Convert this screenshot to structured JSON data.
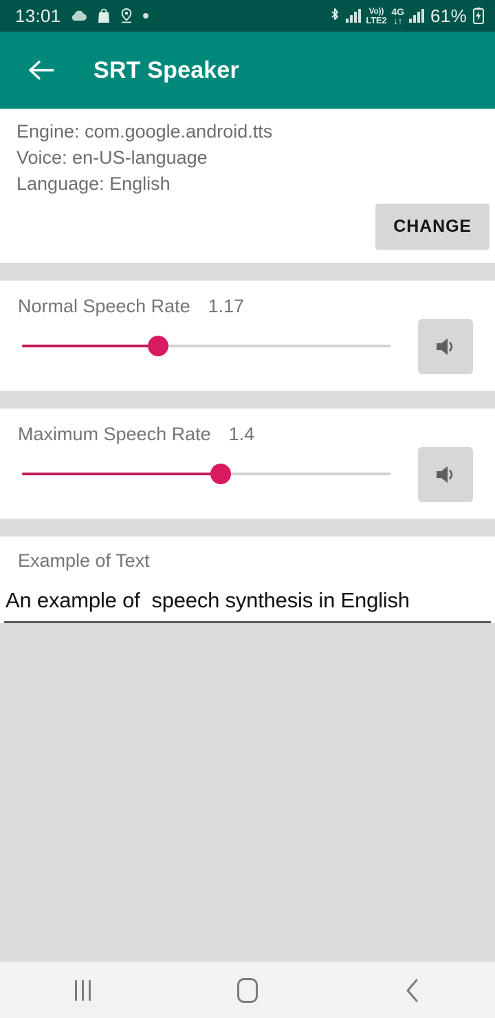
{
  "status_bar": {
    "clock": "13:01",
    "left_icons": [
      "cloud-icon",
      "shopping-bag-icon",
      "location-pin-icon",
      "dot-icon"
    ],
    "bluetooth_icon": "bluetooth-icon",
    "signal_icon_1": "signal-bars-icon",
    "volte_line1": "Vo))",
    "volte_line2": "LTE2",
    "network_type": "4G",
    "data_arrows": "↓↑",
    "signal_icon_2": "signal-bars-icon",
    "battery_percent": "61%",
    "battery_icon": "battery-charging-icon",
    "bg_color": "#005449"
  },
  "app_bar": {
    "back_icon": "arrow-left-icon",
    "title": "SRT Speaker",
    "bg_color": "#00897b"
  },
  "engine_info": {
    "engine": "Engine: com.google.android.tts",
    "voice": "Voice: en-US-language",
    "language": "Language: English"
  },
  "change_button": {
    "label": "CHANGE"
  },
  "normal_rate": {
    "label": "Normal Speech Rate",
    "value": "1.17",
    "slider_percent": 37,
    "speak_icon": "speaker-icon"
  },
  "maximum_rate": {
    "label": "Maximum Speech Rate",
    "value": "1.4",
    "slider_percent": 54,
    "speak_icon": "speaker-icon"
  },
  "example": {
    "label": "Example of Text",
    "value": "An example of  speech synthesis in English",
    "placeholder": "Example of Text"
  },
  "nav_bar": {
    "recents_icon": "recents-icon",
    "home_icon": "home-icon",
    "back_icon": "back-chevron-icon"
  },
  "colors": {
    "accent": "#c2185b",
    "primary": "#00897b",
    "status_bar": "#005449",
    "divider": "#dedddb"
  }
}
